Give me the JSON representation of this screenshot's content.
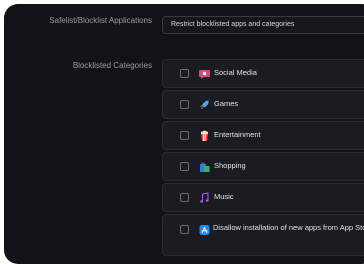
{
  "policy": {
    "label": "Safelist/Blocklist Applications",
    "selected_value": "Restrict blocklisted apps and categories"
  },
  "categories_section": {
    "label": "Blocklisted Categories",
    "items": [
      {
        "label": "Social Media",
        "icon": "speech-bubble-icon",
        "checked": false
      },
      {
        "label": "Games",
        "icon": "rocket-icon",
        "checked": false
      },
      {
        "label": "Entertainment",
        "icon": "popcorn-icon",
        "checked": false
      },
      {
        "label": "Shopping",
        "icon": "shopping-icon",
        "checked": false
      },
      {
        "label": "Music",
        "icon": "music-icon",
        "checked": false
      }
    ],
    "app_store_option": {
      "label": "Disallow installation of new apps from App Store",
      "icon": "app-store-icon",
      "checked": false
    }
  },
  "colors": {
    "panel_background": "#121318",
    "box_background": "#1b1c21",
    "label_text": "#9a9ba1",
    "item_text": "#e2e3e6"
  }
}
